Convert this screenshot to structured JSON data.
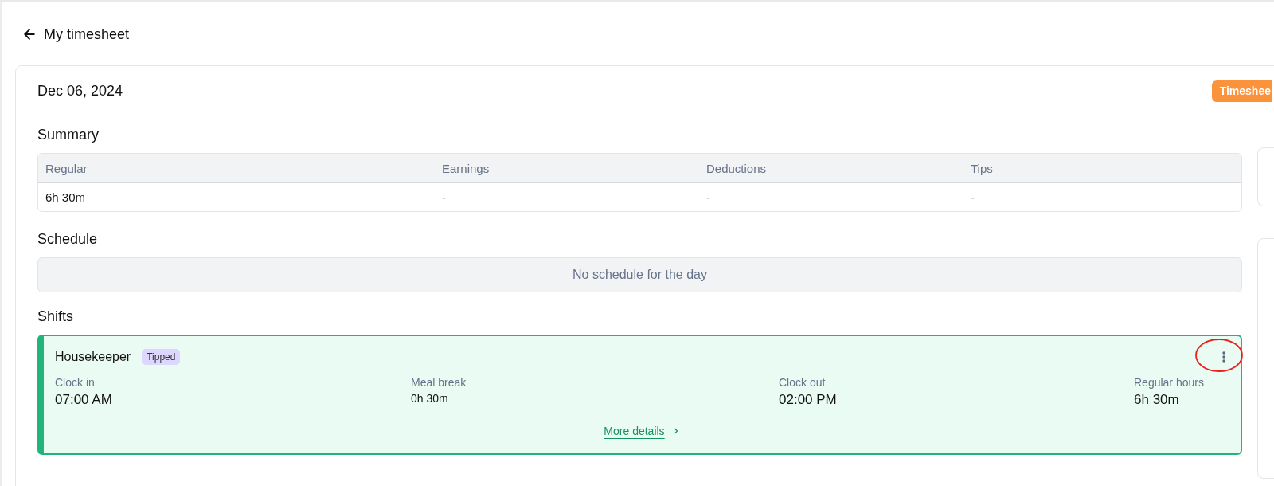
{
  "page": {
    "title": "My timesheet"
  },
  "day": {
    "date": "Dec 06, 2024",
    "status_badge": "Timeshee"
  },
  "summary": {
    "heading": "Summary",
    "columns": [
      "Regular",
      "Earnings",
      "Deductions",
      "Tips"
    ],
    "values": [
      "6h 30m",
      "-",
      "-",
      "-"
    ]
  },
  "schedule": {
    "heading": "Schedule",
    "empty_text": "No schedule for the day"
  },
  "shifts": {
    "heading": "Shifts",
    "items": [
      {
        "role": "Housekeeper",
        "tag": "Tipped",
        "highlighted_menu": true,
        "fields": [
          {
            "label": "Clock in",
            "value": "07:00 AM",
            "emphasis": true
          },
          {
            "label": "Meal break",
            "value": "0h 30m",
            "emphasis": false
          },
          {
            "label": "Clock out",
            "value": "02:00 PM",
            "emphasis": true
          },
          {
            "label": "Regular hours",
            "value": "6h 30m",
            "emphasis": true
          }
        ],
        "link": "More details"
      }
    ]
  }
}
